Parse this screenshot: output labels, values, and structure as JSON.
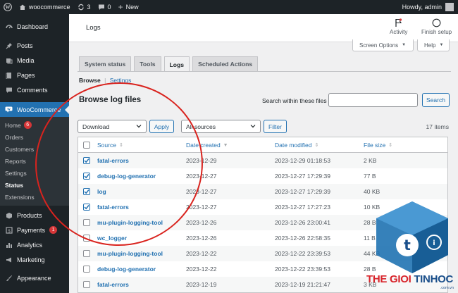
{
  "adminbar": {
    "site_name": "woocommerce",
    "updates_count": "3",
    "comments_count": "0",
    "new_label": "New",
    "howdy": "Howdy, admin"
  },
  "sidebar": {
    "items_top": [
      {
        "label": "Dashboard",
        "icon": "dashboard-icon"
      },
      {
        "label": "Posts",
        "icon": "pin-icon"
      },
      {
        "label": "Media",
        "icon": "media-icon"
      },
      {
        "label": "Pages",
        "icon": "page-icon"
      },
      {
        "label": "Comments",
        "icon": "comment-icon"
      }
    ],
    "woocommerce_label": "WooCommerce",
    "woo_submenu": [
      {
        "label": "Home",
        "badge": "6"
      },
      {
        "label": "Orders"
      },
      {
        "label": "Customers"
      },
      {
        "label": "Reports"
      },
      {
        "label": "Settings"
      },
      {
        "label": "Status",
        "current": true
      },
      {
        "label": "Extensions"
      }
    ],
    "items_bottom": [
      {
        "label": "Products",
        "icon": "box-icon"
      },
      {
        "label": "Payments",
        "icon": "payments-icon",
        "badge": "1"
      },
      {
        "label": "Analytics",
        "icon": "analytics-icon"
      },
      {
        "label": "Marketing",
        "icon": "megaphone-icon"
      },
      {
        "label": "Appearance",
        "icon": "brush-icon"
      }
    ]
  },
  "header": {
    "title": "Logs",
    "activity_label": "Activity",
    "finish_setup_label": "Finish setup"
  },
  "screen_options_label": "Screen Options",
  "help_label": "Help",
  "tabs": [
    {
      "label": "System status",
      "active": false
    },
    {
      "label": "Tools",
      "active": false
    },
    {
      "label": "Logs",
      "active": true
    },
    {
      "label": "Scheduled Actions",
      "active": false
    }
  ],
  "subsubsub": {
    "browse": "Browse",
    "separator": "|",
    "settings": "Settings"
  },
  "page_heading": "Browse log files",
  "search": {
    "label": "Search within these files",
    "button": "Search",
    "value": ""
  },
  "bulk": {
    "selected": "Download",
    "apply": "Apply"
  },
  "source_filter": {
    "selected": "All sources",
    "button": "Filter"
  },
  "items_count": "17 items",
  "table": {
    "columns": [
      "Source",
      "Date created",
      "Date modified",
      "File size"
    ],
    "rows": [
      {
        "checked": true,
        "source": "fatal-errors",
        "created": "2023-12-29",
        "modified": "2023-12-29 01:18:53",
        "size": "2 KB"
      },
      {
        "checked": true,
        "source": "debug-log-generator",
        "created": "2023-12-27",
        "modified": "2023-12-27 17:29:39",
        "size": "77 B"
      },
      {
        "checked": true,
        "source": "log",
        "created": "2023-12-27",
        "modified": "2023-12-27 17:29:39",
        "size": "40 KB"
      },
      {
        "checked": true,
        "source": "fatal-errors",
        "created": "2023-12-27",
        "modified": "2023-12-27 17:27:23",
        "size": "10 KB"
      },
      {
        "checked": false,
        "source": "mu-plugin-logging-tool",
        "created": "2023-12-26",
        "modified": "2023-12-26 23:00:41",
        "size": "28 B"
      },
      {
        "checked": false,
        "source": "wc_logger",
        "created": "2023-12-26",
        "modified": "2023-12-26 22:58:35",
        "size": "11 B"
      },
      {
        "checked": false,
        "source": "mu-plugin-logging-tool",
        "created": "2023-12-22",
        "modified": "2023-12-22 23:39:53",
        "size": "44 KB"
      },
      {
        "checked": false,
        "source": "debug-log-generator",
        "created": "2023-12-22",
        "modified": "2023-12-22 23:39:53",
        "size": "28 B"
      },
      {
        "checked": false,
        "source": "fatal-errors",
        "created": "2023-12-19",
        "modified": "2023-12-19 21:21:47",
        "size": "3 KB"
      }
    ]
  },
  "watermark": {
    "brand_part1": "THE GIOI",
    "brand_part2": "TINHOC",
    "domain": ".com.vn"
  },
  "colors": {
    "accent": "#2271b1",
    "adminbar": "#1d2327",
    "annotation": "#d9231e",
    "badge": "#d63638"
  }
}
